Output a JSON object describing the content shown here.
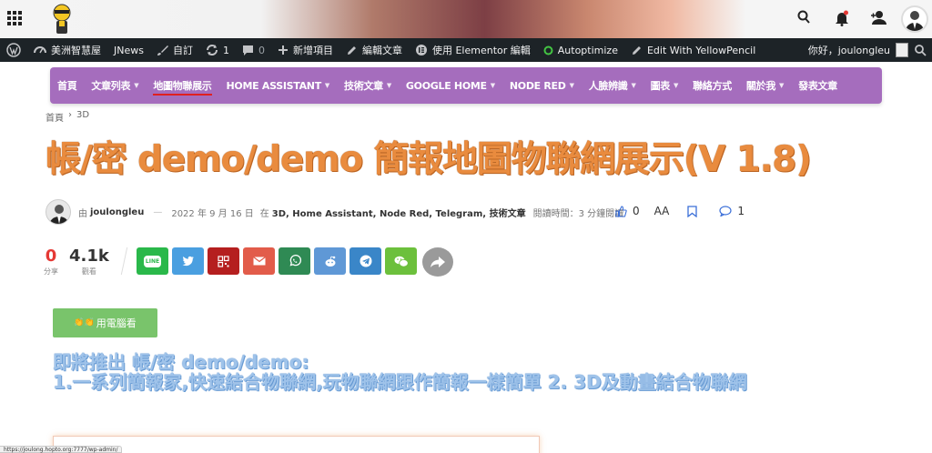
{
  "adminbar": {
    "site_name": "美洲智慧屋",
    "jnews": "JNews",
    "customize": "自訂",
    "updates_count": "1",
    "comments_count": "0",
    "new_item": "新增項目",
    "edit_post": "編輯文章",
    "elementor": "使用 Elementor 編輯",
    "autoptimize": "Autoptimize",
    "yellowpencil": "Edit With YellowPencil",
    "greeting": "你好，joulongleu"
  },
  "nav": {
    "items": [
      {
        "label": "首頁",
        "chevron": false
      },
      {
        "label": "文章列表",
        "chevron": true
      },
      {
        "label": "地圖物聯展示",
        "chevron": false,
        "active": true
      },
      {
        "label": "HOME ASSISTANT",
        "chevron": true
      },
      {
        "label": "技術文章",
        "chevron": true
      },
      {
        "label": "GOOGLE HOME",
        "chevron": true
      },
      {
        "label": "NODE RED",
        "chevron": true
      },
      {
        "label": "人臉辨識",
        "chevron": true
      },
      {
        "label": "圖表",
        "chevron": true
      },
      {
        "label": "聯絡方式",
        "chevron": false
      },
      {
        "label": "關於我",
        "chevron": true
      },
      {
        "label": "發表文章",
        "chevron": false
      }
    ]
  },
  "breadcrumb": {
    "home": "首頁",
    "separator": "›",
    "current": "3D"
  },
  "post": {
    "title": "帳/密 demo/demo 簡報地圖物聯網展示(V 1.8)",
    "by": "由",
    "author": "joulongleu",
    "dash": "—",
    "date": "2022 年 9 月 16 日",
    "in": "在",
    "categories": "3D, Home Assistant, Node Red, Telegram, 技術文章",
    "reading_time": "閱讀時間：3 分鐘閱讀",
    "likes": "0",
    "font_size_label": "AA",
    "comment_count": "1"
  },
  "share": {
    "shares_count": "0",
    "shares_label": "分享",
    "views_count": "4.1k",
    "views_label": "觀看",
    "buttons": [
      {
        "name": "line",
        "label": "LINE",
        "color": "#2ab84a"
      },
      {
        "name": "twitter",
        "label": "",
        "color": "#4a9fe0"
      },
      {
        "name": "qrcode",
        "label": "",
        "color": "#b51f1f"
      },
      {
        "name": "email",
        "label": "",
        "color": "#e25c4a"
      },
      {
        "name": "whatsapp",
        "label": "",
        "color": "#2f8a54"
      },
      {
        "name": "reddit",
        "label": "",
        "color": "#5f98d6"
      },
      {
        "name": "telegram",
        "label": "",
        "color": "#3a86c8"
      },
      {
        "name": "wechat",
        "label": "",
        "color": "#6cc03c"
      }
    ]
  },
  "green_button": {
    "label": "用電腦看",
    "emoji": "👏👏"
  },
  "blue_heading": {
    "line1": "即將推出 帳/密 demo/demo:",
    "line2": "1.一系列簡報家,快速結合物聯網,玩物聯網跟作簡報一樣簡單 2. 3D及動畫結合物聯網"
  },
  "status_url": "https://joulong.hopto.org:7777/wp-admin/",
  "colors": {
    "admin_bar": "#1d2327",
    "nav": "#a56dbd",
    "title": "#e98b3e",
    "heading": "#9fc3ea",
    "green_button": "#79c46b"
  }
}
